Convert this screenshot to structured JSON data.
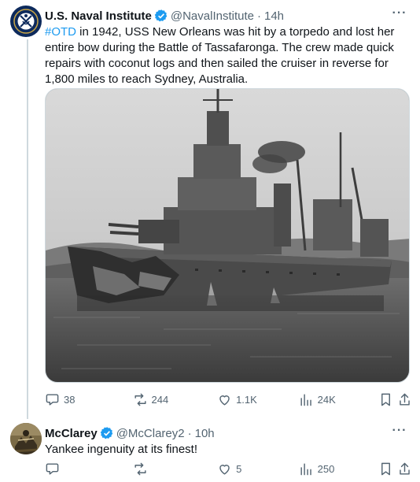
{
  "tweet": {
    "author_name": "U.S. Naval Institute",
    "handle": "@NavalInstitute",
    "separator": "·",
    "time": "14h",
    "hashtag": "#OTD",
    "text": " in 1942, USS New Orleans was hit by a torpedo and lost her entire bow during the Battle of Tassafaronga. The crew made quick repairs with coconut logs and then sailed the cruiser in reverse for 1,800 miles to reach Sydney, Australia.",
    "replies": "38",
    "reposts": "244",
    "likes": "1.1K",
    "views": "24K"
  },
  "reply": {
    "author_name": "McClarey",
    "handle": "@McClarey2",
    "separator": "·",
    "time": "10h",
    "text": "Yankee ingenuity at its finest!",
    "replies": "",
    "reposts": "",
    "likes": "5",
    "views": "250"
  },
  "colors": {
    "accent": "#1d9bf0",
    "text": "#0f1419",
    "muted": "#536471",
    "border": "#cfd9de"
  },
  "icons": [
    "more-icon",
    "verified-icon",
    "reply-icon",
    "repost-icon",
    "like-icon",
    "views-icon",
    "bookmark-icon",
    "share-icon"
  ]
}
